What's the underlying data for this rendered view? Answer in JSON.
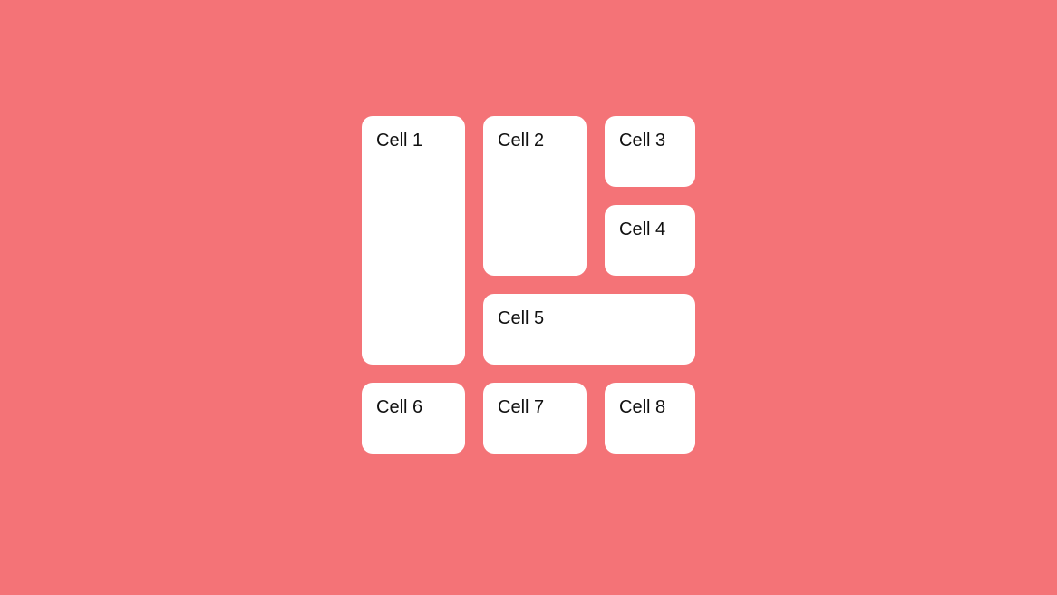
{
  "cells": {
    "c1": "Cell 1",
    "c2": "Cell 2",
    "c3": "Cell 3",
    "c4": "Cell 4",
    "c5": "Cell 5",
    "c6": "Cell 6",
    "c7": "Cell 7",
    "c8": "Cell 8"
  }
}
